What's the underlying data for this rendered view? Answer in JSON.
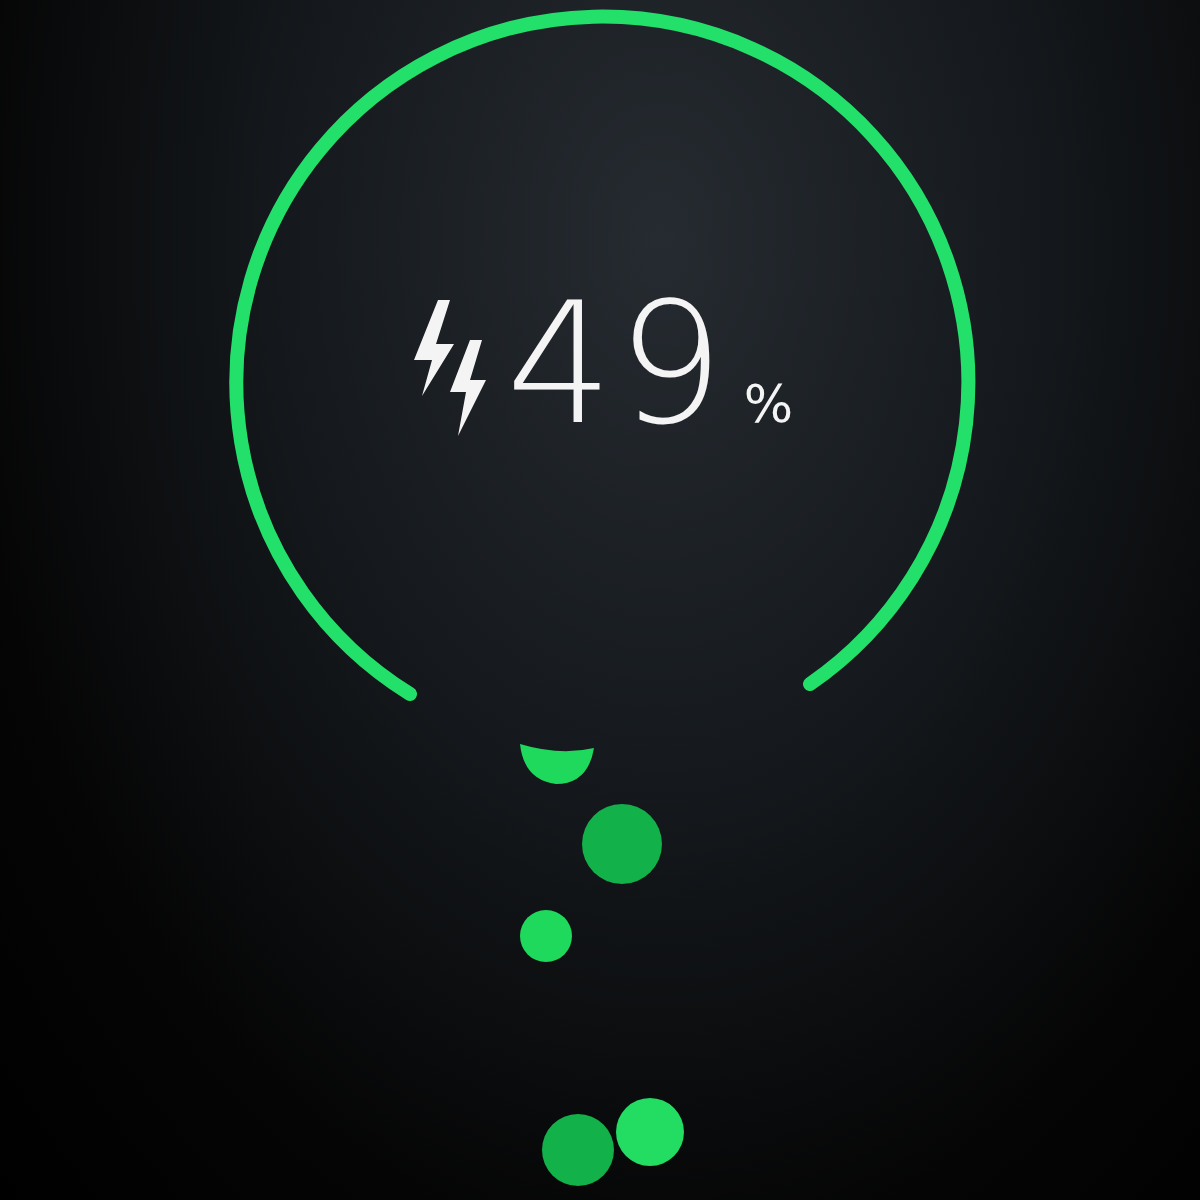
{
  "battery": {
    "percent": "49",
    "unit": "%",
    "charging": true
  }
}
